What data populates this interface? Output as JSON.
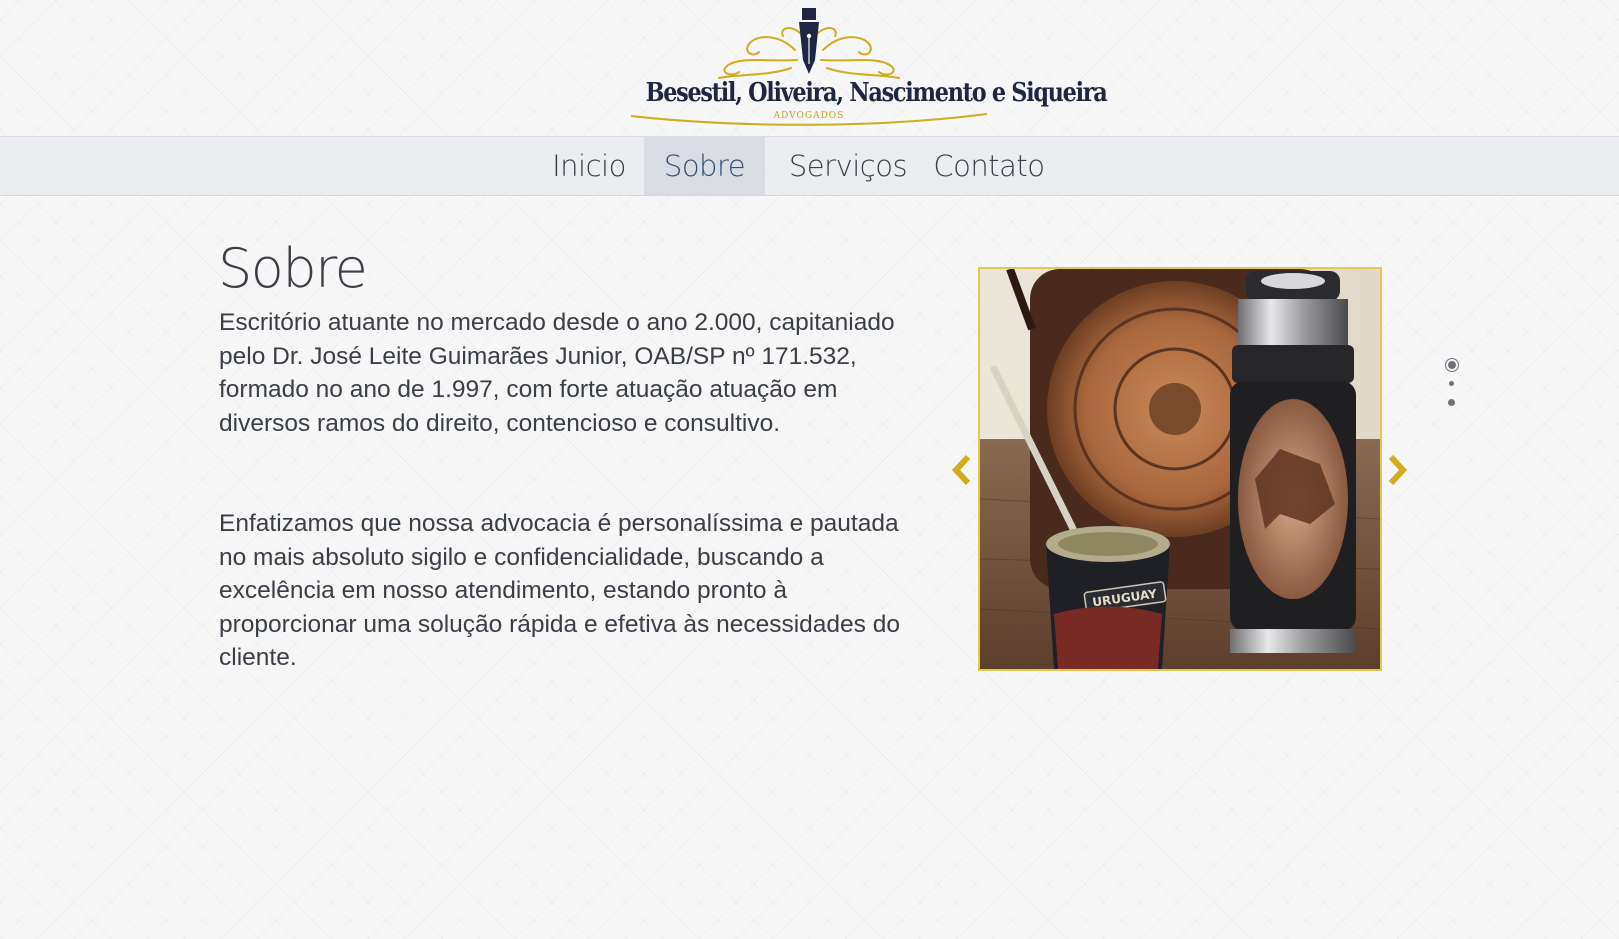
{
  "header": {
    "firm_name": "Besestil, Oliveira, Nascimento e Siqueira",
    "firm_subtitle": "ADVOGADOS",
    "logo_icon": "fountain-pen-nib-icon"
  },
  "nav": {
    "items": [
      {
        "label": "Inicio",
        "active": false
      },
      {
        "label": "Sobre",
        "active": true
      },
      {
        "label": "Serviços",
        "active": false
      },
      {
        "label": "Contato",
        "active": false
      }
    ]
  },
  "main": {
    "title": "Sobre",
    "paragraphs": [
      "Escritório atuante no mercado desde o ano 2.000, capitaniado pelo Dr. José Leite Guimarães Junior, OAB/SP nº 171.532, formado no ano de 1.997, com forte atuação atuação em diversos ramos do direito, contencioso e consultivo.",
      "Enfatizamos que nossa advocacia é personalíssima e pautada no mais absoluto sigilo e confidencialidade, buscando a excelência em nosso atendimento, estando pronto à proporcionar uma solução rápida e efetiva às necessidades do cliente."
    ]
  },
  "slider": {
    "image_caption": "URUGUAY",
    "prev_icon": "chevron-left-icon",
    "next_icon": "chevron-right-icon",
    "dot_count": 3,
    "active_dot": 0
  },
  "colors": {
    "accent_gold": "#d4aa1f",
    "navy": "#1d2744",
    "text": "#3a3e47",
    "nav_active_bg": "#d9dde3",
    "nav_active_text": "#344e73"
  }
}
